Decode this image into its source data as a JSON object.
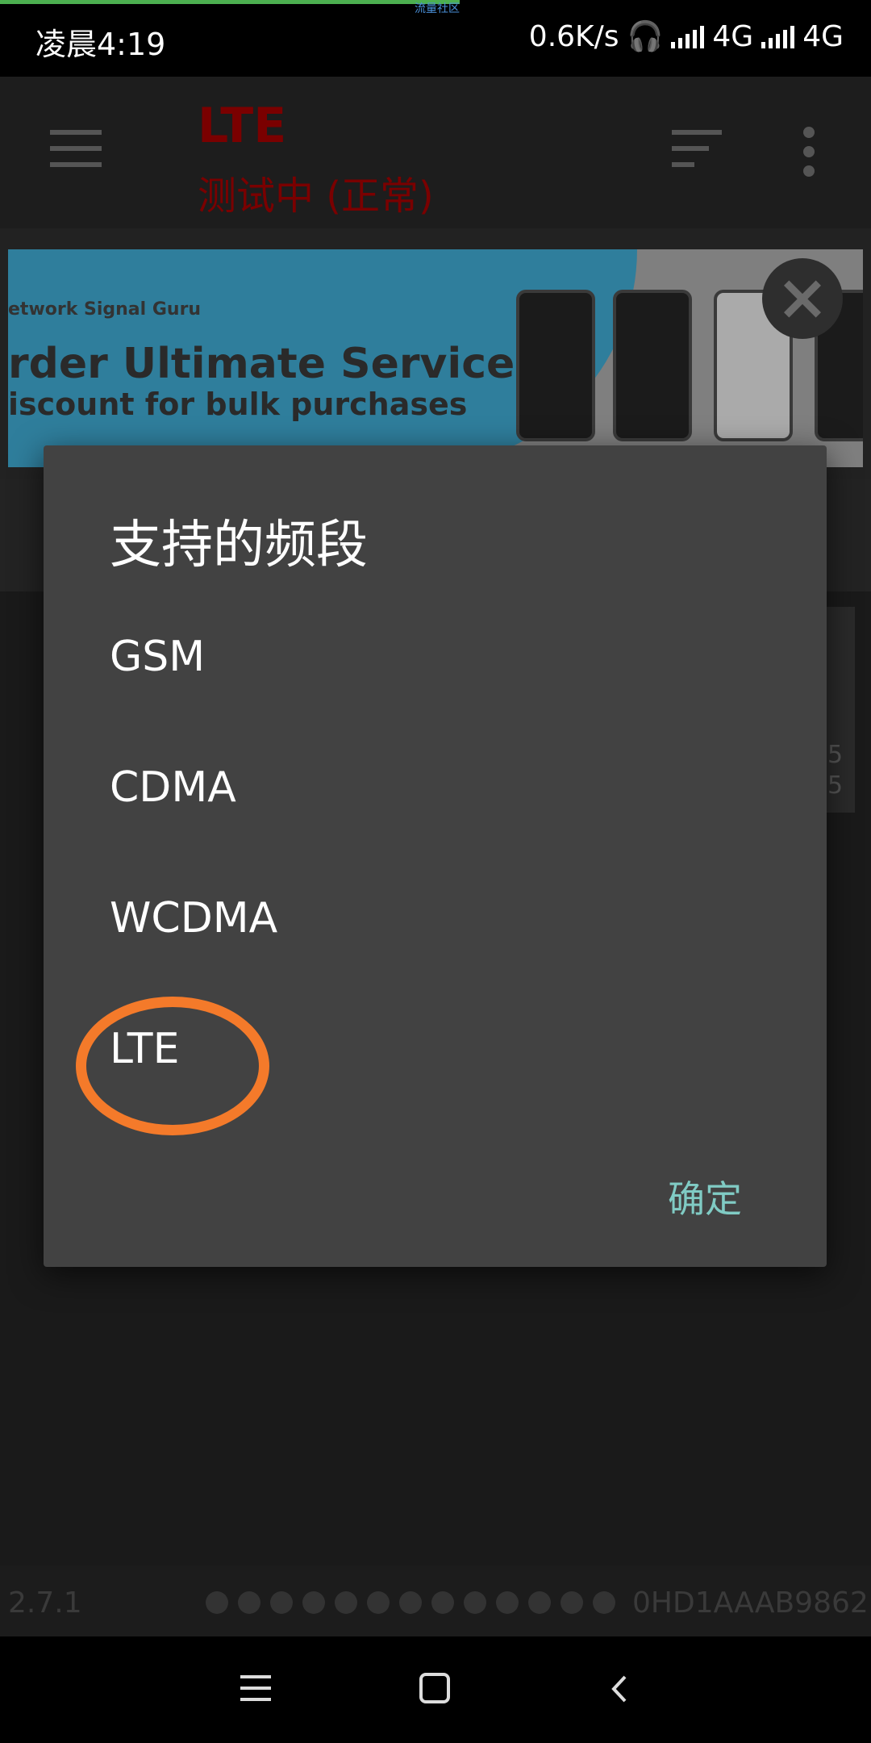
{
  "status_bar": {
    "time": "凌晨4:19",
    "speed": "0.6K/s",
    "network1": "4G",
    "network2": "4G",
    "loading_text": "流量社区"
  },
  "app": {
    "title": "LTE",
    "subtitle": "测试中 (正常)",
    "banner": {
      "line1": "etwork Signal Guru",
      "line2": "rder Ultimate Service",
      "line3": "iscount for bulk purchases"
    },
    "side_values": [
      "5",
      "5"
    ],
    "footer": {
      "version": "2.7.1",
      "page_dots": 13,
      "device_id": "0HD1AAAB9862"
    }
  },
  "dialog": {
    "title": "支持的频段",
    "options": [
      "GSM",
      "CDMA",
      "WCDMA",
      "LTE"
    ],
    "highlighted_option": "LTE",
    "confirm_label": "确定"
  },
  "colors": {
    "dialog_bg": "#424242",
    "accent": "#80cbc4",
    "highlight": "#f47a2a",
    "app_title": "#b00000"
  }
}
